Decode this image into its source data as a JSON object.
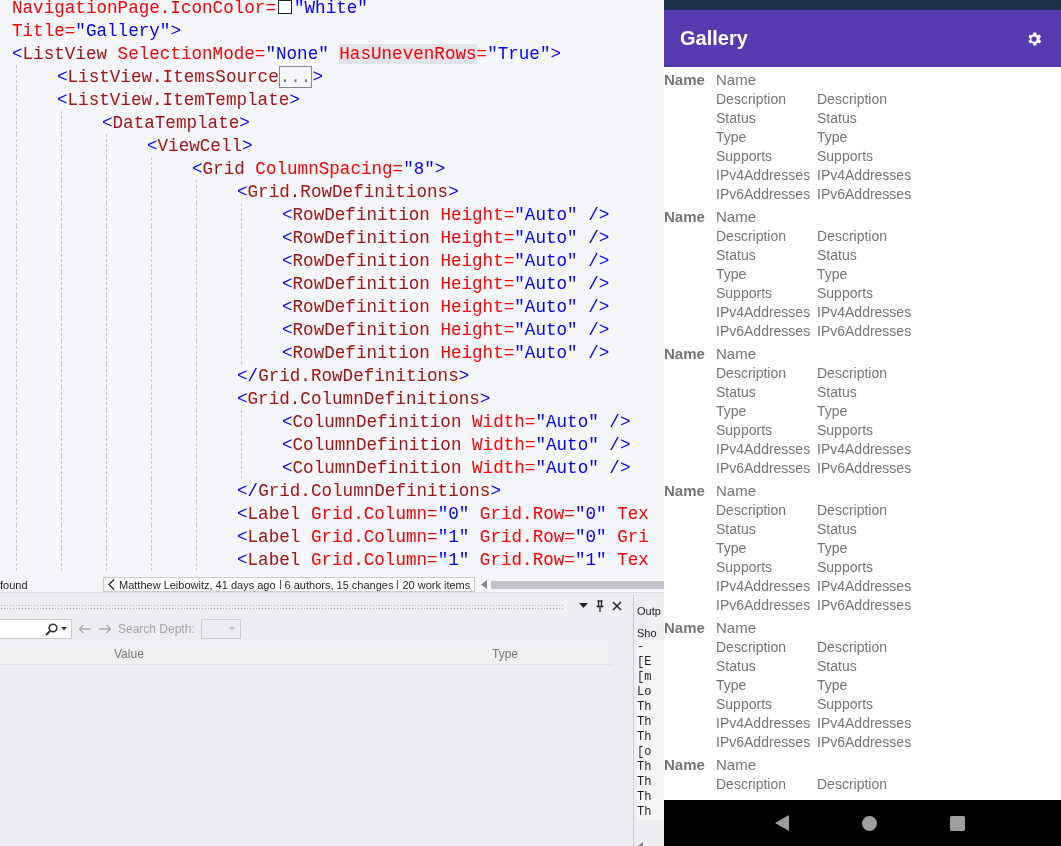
{
  "editor": {
    "lines": [
      {
        "tokens": [
          {
            "kind": "attr",
            "t": "NavigationPage.IconColor="
          },
          {
            "kind": "swatch",
            "color": "#ffffff"
          },
          {
            "kind": "val",
            "t": "\"White\""
          }
        ]
      },
      {
        "tokens": [
          {
            "kind": "attr",
            "t": "Title="
          },
          {
            "kind": "val",
            "t": "\"Gallery\">"
          }
        ]
      },
      {
        "tokens": [
          {
            "kind": "punct",
            "t": "<"
          },
          {
            "kind": "elem",
            "t": "ListView "
          },
          {
            "kind": "attr",
            "t": "SelectionMode="
          },
          {
            "kind": "val",
            "t": "\"None\" "
          },
          {
            "kind": "attr_hl",
            "t": "HasUnevenRows"
          },
          {
            "kind": "attr",
            "t": "="
          },
          {
            "kind": "val",
            "t": "\"True\">"
          }
        ],
        "children": [
          {
            "tokens": [
              {
                "kind": "punct",
                "t": "<"
              },
              {
                "kind": "elem",
                "t": "ListView.ItemsSource"
              },
              {
                "kind": "fold",
                "t": "..."
              },
              {
                "kind": "punct",
                "t": ">"
              }
            ]
          },
          {
            "tokens": [
              {
                "kind": "punct",
                "t": "<"
              },
              {
                "kind": "elem",
                "t": "ListView.ItemTemplate"
              },
              {
                "kind": "punct",
                "t": ">"
              }
            ],
            "children": [
              {
                "tokens": [
                  {
                    "kind": "punct",
                    "t": "<"
                  },
                  {
                    "kind": "elem",
                    "t": "DataTemplate"
                  },
                  {
                    "kind": "punct",
                    "t": ">"
                  }
                ],
                "children": [
                  {
                    "tokens": [
                      {
                        "kind": "punct",
                        "t": "<"
                      },
                      {
                        "kind": "elem",
                        "t": "ViewCell"
                      },
                      {
                        "kind": "punct",
                        "t": ">"
                      }
                    ],
                    "children": [
                      {
                        "tokens": [
                          {
                            "kind": "punct",
                            "t": "<"
                          },
                          {
                            "kind": "elem",
                            "t": "Grid "
                          },
                          {
                            "kind": "attr",
                            "t": "ColumnSpacing="
                          },
                          {
                            "kind": "val",
                            "t": "\"8\">"
                          }
                        ],
                        "children": [
                          {
                            "tokens": [
                              {
                                "kind": "punct",
                                "t": "<"
                              },
                              {
                                "kind": "elem",
                                "t": "Grid.RowDefinitions"
                              },
                              {
                                "kind": "punct",
                                "t": ">"
                              }
                            ],
                            "children": [
                              {
                                "tokens": [
                                  {
                                    "kind": "punct",
                                    "t": "<"
                                  },
                                  {
                                    "kind": "elem",
                                    "t": "RowDefinition "
                                  },
                                  {
                                    "kind": "attr",
                                    "t": "Height="
                                  },
                                  {
                                    "kind": "val",
                                    "t": "\"Auto\" />"
                                  }
                                ]
                              },
                              {
                                "tokens": [
                                  {
                                    "kind": "punct",
                                    "t": "<"
                                  },
                                  {
                                    "kind": "elem",
                                    "t": "RowDefinition "
                                  },
                                  {
                                    "kind": "attr",
                                    "t": "Height="
                                  },
                                  {
                                    "kind": "val",
                                    "t": "\"Auto\" />"
                                  }
                                ]
                              },
                              {
                                "tokens": [
                                  {
                                    "kind": "punct",
                                    "t": "<"
                                  },
                                  {
                                    "kind": "elem",
                                    "t": "RowDefinition "
                                  },
                                  {
                                    "kind": "attr",
                                    "t": "Height="
                                  },
                                  {
                                    "kind": "val",
                                    "t": "\"Auto\" />"
                                  }
                                ]
                              },
                              {
                                "tokens": [
                                  {
                                    "kind": "punct",
                                    "t": "<"
                                  },
                                  {
                                    "kind": "elem",
                                    "t": "RowDefinition "
                                  },
                                  {
                                    "kind": "attr",
                                    "t": "Height="
                                  },
                                  {
                                    "kind": "val",
                                    "t": "\"Auto\" />"
                                  }
                                ]
                              },
                              {
                                "tokens": [
                                  {
                                    "kind": "punct",
                                    "t": "<"
                                  },
                                  {
                                    "kind": "elem",
                                    "t": "RowDefinition "
                                  },
                                  {
                                    "kind": "attr",
                                    "t": "Height="
                                  },
                                  {
                                    "kind": "val",
                                    "t": "\"Auto\" />"
                                  }
                                ]
                              },
                              {
                                "tokens": [
                                  {
                                    "kind": "punct",
                                    "t": "<"
                                  },
                                  {
                                    "kind": "elem",
                                    "t": "RowDefinition "
                                  },
                                  {
                                    "kind": "attr",
                                    "t": "Height="
                                  },
                                  {
                                    "kind": "val",
                                    "t": "\"Auto\" />"
                                  }
                                ]
                              },
                              {
                                "tokens": [
                                  {
                                    "kind": "punct",
                                    "t": "<"
                                  },
                                  {
                                    "kind": "elem",
                                    "t": "RowDefinition "
                                  },
                                  {
                                    "kind": "attr",
                                    "t": "Height="
                                  },
                                  {
                                    "kind": "val",
                                    "t": "\"Auto\" />"
                                  }
                                ]
                              }
                            ]
                          },
                          {
                            "tokens": [
                              {
                                "kind": "punct",
                                "t": "</"
                              },
                              {
                                "kind": "elem",
                                "t": "Grid.RowDefinitions"
                              },
                              {
                                "kind": "punct",
                                "t": ">"
                              }
                            ]
                          },
                          {
                            "tokens": [
                              {
                                "kind": "punct",
                                "t": "<"
                              },
                              {
                                "kind": "elem",
                                "t": "Grid.ColumnDefinitions"
                              },
                              {
                                "kind": "punct",
                                "t": ">"
                              }
                            ],
                            "children": [
                              {
                                "tokens": [
                                  {
                                    "kind": "punct",
                                    "t": "<"
                                  },
                                  {
                                    "kind": "elem",
                                    "t": "ColumnDefinition "
                                  },
                                  {
                                    "kind": "attr",
                                    "t": "Width="
                                  },
                                  {
                                    "kind": "val",
                                    "t": "\"Auto\" />"
                                  }
                                ]
                              },
                              {
                                "tokens": [
                                  {
                                    "kind": "punct",
                                    "t": "<"
                                  },
                                  {
                                    "kind": "elem",
                                    "t": "ColumnDefinition "
                                  },
                                  {
                                    "kind": "attr",
                                    "t": "Width="
                                  },
                                  {
                                    "kind": "val",
                                    "t": "\"Auto\" />"
                                  }
                                ]
                              },
                              {
                                "tokens": [
                                  {
                                    "kind": "punct",
                                    "t": "<"
                                  },
                                  {
                                    "kind": "elem",
                                    "t": "ColumnDefinition "
                                  },
                                  {
                                    "kind": "attr",
                                    "t": "Width="
                                  },
                                  {
                                    "kind": "val",
                                    "t": "\"Auto\" />"
                                  }
                                ]
                              }
                            ]
                          },
                          {
                            "tokens": [
                              {
                                "kind": "punct",
                                "t": "</"
                              },
                              {
                                "kind": "elem",
                                "t": "Grid.ColumnDefinitions"
                              },
                              {
                                "kind": "punct",
                                "t": ">"
                              }
                            ]
                          },
                          {
                            "tokens": [
                              {
                                "kind": "punct",
                                "t": "<"
                              },
                              {
                                "kind": "elem",
                                "t": "Label "
                              },
                              {
                                "kind": "attr",
                                "t": "Grid.Column="
                              },
                              {
                                "kind": "val",
                                "t": "\"0\" "
                              },
                              {
                                "kind": "attr",
                                "t": "Grid.Row="
                              },
                              {
                                "kind": "val",
                                "t": "\"0\" "
                              },
                              {
                                "kind": "attr",
                                "t": "Tex"
                              }
                            ]
                          },
                          {
                            "tokens": [
                              {
                                "kind": "punct",
                                "t": "<"
                              },
                              {
                                "kind": "elem",
                                "t": "Label "
                              },
                              {
                                "kind": "attr",
                                "t": "Grid.Column="
                              },
                              {
                                "kind": "val",
                                "t": "\"1\" "
                              },
                              {
                                "kind": "attr",
                                "t": "Grid.Row="
                              },
                              {
                                "kind": "val",
                                "t": "\"0\" "
                              },
                              {
                                "kind": "attr",
                                "t": "Gri"
                              }
                            ]
                          },
                          {
                            "tokens": [
                              {
                                "kind": "punct",
                                "t": "<"
                              },
                              {
                                "kind": "elem",
                                "t": "Label "
                              },
                              {
                                "kind": "attr",
                                "t": "Grid.Column="
                              },
                              {
                                "kind": "val",
                                "t": "\"1\" "
                              },
                              {
                                "kind": "attr",
                                "t": "Grid.Row="
                              },
                              {
                                "kind": "val",
                                "t": "\"1\" "
                              },
                              {
                                "kind": "attr",
                                "t": "Tex"
                              }
                            ]
                          }
                        ]
                      }
                    ]
                  }
                ]
              }
            ]
          }
        ]
      }
    ],
    "find_status": "found",
    "blame": "Matthew Leibowitz, 41 days ago",
    "history": "6 authors, 15 changes",
    "work_items": "20 work items"
  },
  "locals_panel": {
    "search_depth_label": "Search Depth:",
    "columns": [
      "Value",
      "Type"
    ]
  },
  "output_panel": {
    "tab": "Outp",
    "show_label": "Sho",
    "lines": [
      "-",
      "[E",
      "[m",
      "Lo",
      "Th",
      "Th",
      "Th",
      "[o",
      "Th",
      "Th",
      "Th",
      "Th"
    ]
  },
  "phone": {
    "title": "Gallery",
    "items": [
      {
        "name_label": "Name",
        "name_value": "Name",
        "rows": [
          {
            "label": "Description",
            "value": "Description"
          },
          {
            "label": "Status",
            "value": "Status"
          },
          {
            "label": "Type",
            "value": "Type"
          },
          {
            "label": "Supports",
            "value": "Supports"
          },
          {
            "label": "IPv4Addresses",
            "value": "IPv4Addresses"
          },
          {
            "label": "IPv6Addresses",
            "value": "IPv6Addresses"
          }
        ]
      },
      {
        "name_label": "Name",
        "name_value": "Name",
        "rows": [
          {
            "label": "Description",
            "value": "Description"
          },
          {
            "label": "Status",
            "value": "Status"
          },
          {
            "label": "Type",
            "value": "Type"
          },
          {
            "label": "Supports",
            "value": "Supports"
          },
          {
            "label": "IPv4Addresses",
            "value": "IPv4Addresses"
          },
          {
            "label": "IPv6Addresses",
            "value": "IPv6Addresses"
          }
        ]
      },
      {
        "name_label": "Name",
        "name_value": "Name",
        "rows": [
          {
            "label": "Description",
            "value": "Description"
          },
          {
            "label": "Status",
            "value": "Status"
          },
          {
            "label": "Type",
            "value": "Type"
          },
          {
            "label": "Supports",
            "value": "Supports"
          },
          {
            "label": "IPv4Addresses",
            "value": "IPv4Addresses"
          },
          {
            "label": "IPv6Addresses",
            "value": "IPv6Addresses"
          }
        ]
      },
      {
        "name_label": "Name",
        "name_value": "Name",
        "rows": [
          {
            "label": "Description",
            "value": "Description"
          },
          {
            "label": "Status",
            "value": "Status"
          },
          {
            "label": "Type",
            "value": "Type"
          },
          {
            "label": "Supports",
            "value": "Supports"
          },
          {
            "label": "IPv4Addresses",
            "value": "IPv4Addresses"
          },
          {
            "label": "IPv6Addresses",
            "value": "IPv6Addresses"
          }
        ]
      },
      {
        "name_label": "Name",
        "name_value": "Name",
        "rows": [
          {
            "label": "Description",
            "value": "Description"
          },
          {
            "label": "Status",
            "value": "Status"
          },
          {
            "label": "Type",
            "value": "Type"
          },
          {
            "label": "Supports",
            "value": "Supports"
          },
          {
            "label": "IPv4Addresses",
            "value": "IPv4Addresses"
          },
          {
            "label": "IPv6Addresses",
            "value": "IPv6Addresses"
          }
        ]
      },
      {
        "name_label": "Name",
        "name_value": "Name",
        "rows": [
          {
            "label": "Description",
            "value": "Description"
          }
        ]
      }
    ]
  }
}
